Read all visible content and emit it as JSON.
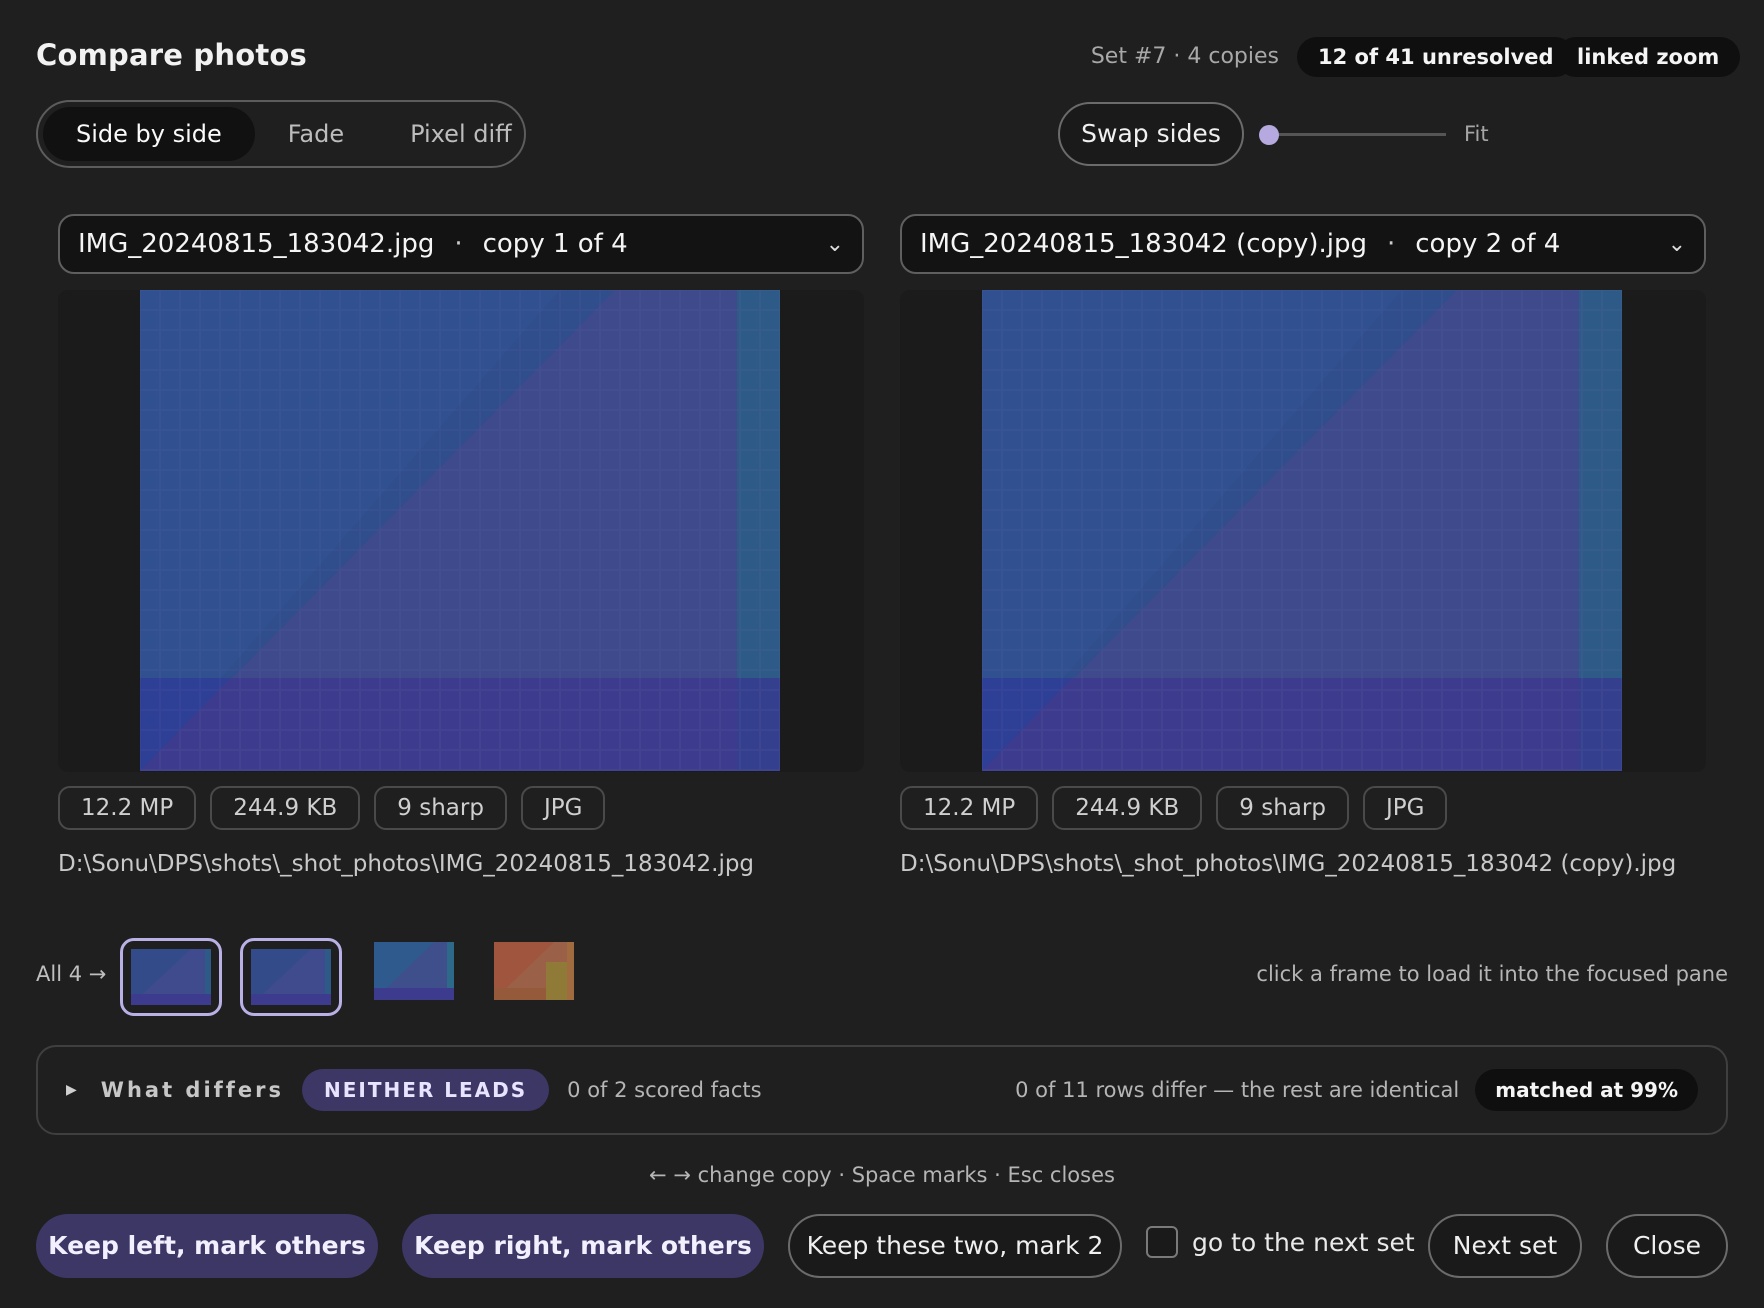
{
  "header": {
    "title": "Compare photos",
    "set_info": "Set #7 · 4 copies",
    "unresolved": "12 of 41 unresolved",
    "linked_zoom": "linked zoom"
  },
  "modes": [
    "Side by side",
    "Fade",
    "Pixel diff"
  ],
  "active_mode": "Side by side",
  "swap_label": "Swap sides",
  "zoom": {
    "label": "Fit",
    "level": 0
  },
  "left": {
    "filename": "IMG_20240815_183042.jpg",
    "sep": "·",
    "copy": "copy 1 of 4",
    "badges": [
      "12.2 MP",
      "244.9 KB",
      "9 sharp",
      "JPG"
    ],
    "path": "D:\\Sonu\\DPS\\shots\\_shot_photos\\IMG_20240815_183042.jpg"
  },
  "right": {
    "filename": "IMG_20240815_183042 (copy).jpg",
    "sep": "·",
    "copy": "copy 2 of 4",
    "badges": [
      "12.2 MP",
      "244.9 KB",
      "9 sharp",
      "JPG"
    ],
    "path": "D:\\Sonu\\DPS\\shots\\_shot_photos\\IMG_20240815_183042 (copy).jpg"
  },
  "strip": {
    "all_label": "All 4 →",
    "hint": "click a frame to load it into the focused pane"
  },
  "differs": {
    "title": "What differs",
    "lead": "NEITHER LEADS",
    "scored": "0 of 2 scored facts",
    "rows": "0 of 11 rows differ — the rest are identical",
    "match": "matched at 99%"
  },
  "shortcuts": "← → change copy · Space marks · Esc closes",
  "actions": {
    "keep_left": "Keep left, mark others",
    "keep_right": "Keep right, mark others",
    "keep_two": "Keep these two, mark 2",
    "next_checkbox": "go to the next set",
    "next_set": "Next set",
    "close": "Close"
  },
  "colors": {
    "accent": "#3d3766",
    "accent_light": "#b9b0e6",
    "photo_blue": "#344b8a",
    "photo_teal": "#2e6e8a",
    "photo_purple": "#443a86"
  }
}
